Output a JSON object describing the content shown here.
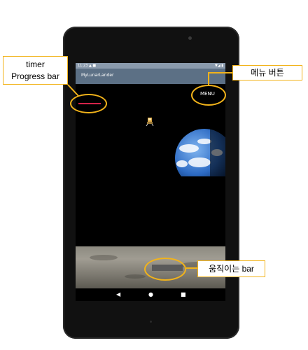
{
  "status_bar": {
    "left_text": "11:23 ▲ ■",
    "right_text": "▼◢ ▮"
  },
  "app_bar": {
    "title": "MyLunarLander"
  },
  "menu_button": {
    "label": "MENU"
  },
  "nav_bar": {
    "back_glyph": "◀",
    "home_glyph": "●",
    "recents_glyph": "■"
  },
  "annotations": {
    "timer_label_line1": "timer",
    "timer_label_line2": "Progress bar",
    "menu_label": "메뉴 버튼",
    "bar_label": "움직이는 bar"
  },
  "colors": {
    "annotation_accent": "#f2b31a",
    "timer_bar": "#d4234a",
    "app_bar": "#5c7085",
    "status_bar": "#8a9aac"
  },
  "icons": {
    "lander": "lunar-lander-icon",
    "earth": "earth-image"
  }
}
